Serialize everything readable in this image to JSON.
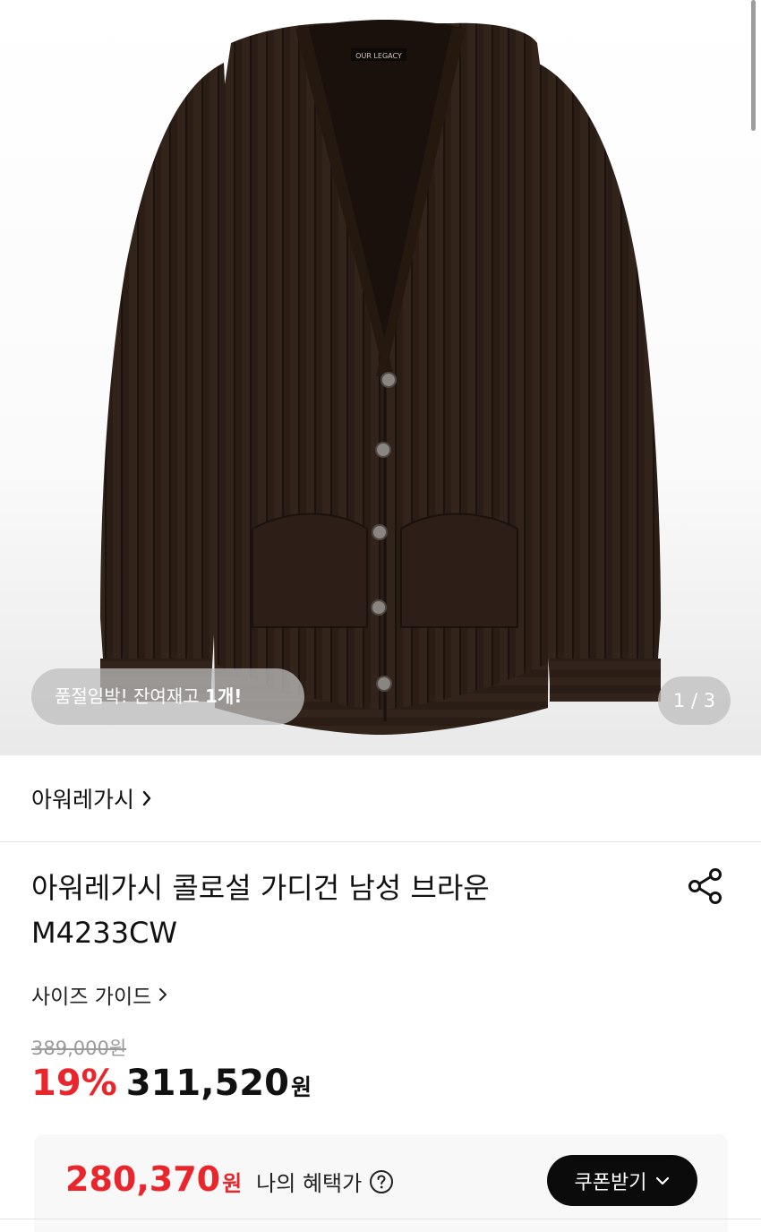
{
  "gallery": {
    "image_alt": "brown ribbed knit v-neck cardigan",
    "stock_badge_prefix": "품절임박! 잔여재고 ",
    "stock_badge_count": "1개!",
    "page_counter": "1 / 3"
  },
  "brand": {
    "name": "아워레가시"
  },
  "product": {
    "title_line1": "아워레가시 콜로설 가디건 남성 브라운",
    "title_line2": "M4233CW"
  },
  "size_guide_label": "사이즈 가이드",
  "price": {
    "original": "389,000원",
    "discount": "19%",
    "sale": "311,520",
    "unit": "원"
  },
  "benefit": {
    "amount": "280,370",
    "unit": "원",
    "label": "나의 혜택가",
    "coupon_button": "쿠폰받기"
  },
  "colors": {
    "accent_red": "#e8262c",
    "button_black": "#0b0b0b",
    "garment_brown": "#2b1e17"
  }
}
